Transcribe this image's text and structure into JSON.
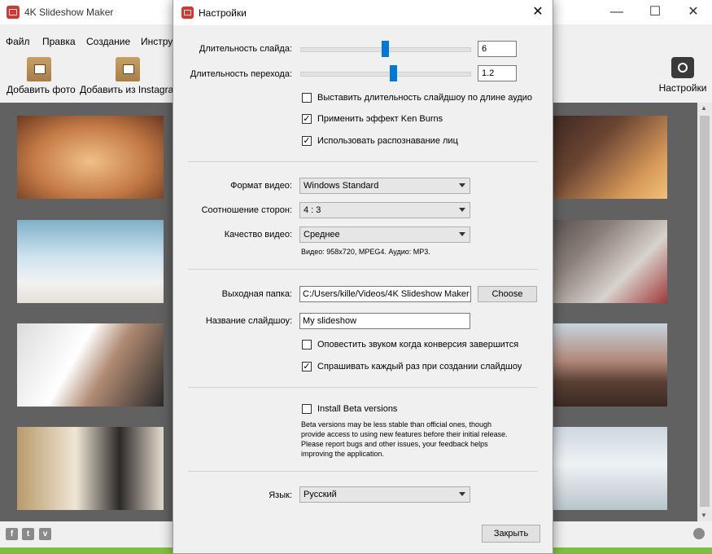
{
  "app": {
    "title": "4K Slideshow Maker",
    "window_controls": {
      "minimize": "—",
      "maximize": "☐",
      "close": "✕"
    }
  },
  "menu": [
    "Файл",
    "Правка",
    "Создание",
    "Инстру"
  ],
  "toolbar": {
    "add_photo": "Добавить фото",
    "add_instagram": "Добавить из Instagram",
    "settings": "Настройки"
  },
  "footer": {
    "social": [
      "f",
      "t",
      "v"
    ]
  },
  "dialog": {
    "title": "Настройки",
    "close": "✕",
    "slide_duration": {
      "label": "Длительность слайда:",
      "value": "6",
      "slider_fraction": 0.5
    },
    "transition_duration": {
      "label": "Длительность перехода:",
      "value": "1.2",
      "slider_fraction": 0.55
    },
    "checkboxes": {
      "fit_audio": {
        "label": "Выставить длительность слайдшоу по длине аудио",
        "checked": false
      },
      "ken_burns": {
        "label": "Применить эффект Ken Burns",
        "checked": true
      },
      "face_recognition": {
        "label": "Использовать распознавание лиц",
        "checked": true
      }
    },
    "video_format": {
      "label": "Формат видео:",
      "value": "Windows Standard"
    },
    "aspect_ratio": {
      "label": "Соотношение сторон:",
      "value": "4 : 3"
    },
    "video_quality": {
      "label": "Качество видео:",
      "value": "Среднее"
    },
    "video_info": "Видео: 958x720, MPEG4. Аудио: MP3.",
    "output_folder": {
      "label": "Выходная папка:",
      "value": "C:/Users/kille/Videos/4K Slideshow Maker",
      "choose": "Choose"
    },
    "slideshow_name": {
      "label": "Название слайдшоу:",
      "value": "My slideshow"
    },
    "notify_sound": {
      "label": "Оповестить звуком когда конверсия завершится",
      "checked": false
    },
    "ask_each_time": {
      "label": "Спрашивать каждый раз при создании слайдшоу",
      "checked": true
    },
    "beta": {
      "label": "Install Beta versions",
      "checked": false,
      "lines": [
        "Beta versions may be less stable than official ones, though",
        "provide access to using new features before their initial release.",
        "Please report bugs and other issues, your feedback helps",
        "improving the application."
      ]
    },
    "language": {
      "label": "Язык:",
      "value": "Русский"
    },
    "close_button": "Закрыть"
  }
}
